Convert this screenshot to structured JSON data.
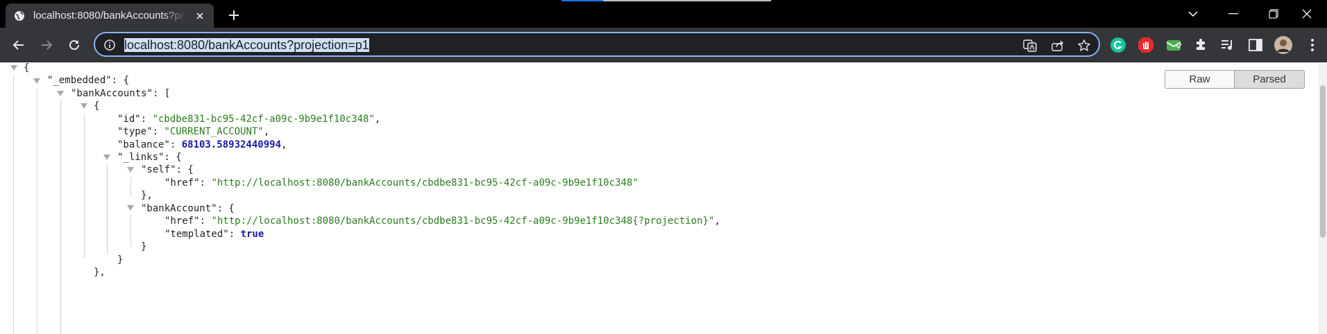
{
  "tab": {
    "title": "localhost:8080/bankAccounts?projection=p1"
  },
  "omnibox": {
    "url": "localhost:8080/bankAccounts?projection=p1"
  },
  "viewer": {
    "raw_label": "Raw",
    "parsed_label": "Parsed"
  },
  "json": {
    "open_brace": "{",
    "embedded_key": "\"_embedded\"",
    "bankaccounts_key": "\"bankAccounts\"",
    "id_key": "\"id\"",
    "id_value": "\"cbdbe831-bc95-42cf-a09c-9b9e1f10c348\"",
    "type_key": "\"type\"",
    "type_value": "\"CURRENT_ACCOUNT\"",
    "balance_key": "\"balance\"",
    "balance_value": "68103.58932440994",
    "links_key": "\"_links\"",
    "self_key": "\"self\"",
    "href_key": "\"href\"",
    "self_href": "\"http://localhost:8080/bankAccounts/cbdbe831-bc95-42cf-a09c-9b9e1f10c348\"",
    "bankaccount_key": "\"bankAccount\"",
    "bankaccount_href": "\"http://localhost:8080/bankAccounts/cbdbe831-bc95-42cf-a09c-9b9e1f10c348{?projection}\"",
    "templated_key": "\"templated\"",
    "templated_value": "true"
  },
  "colors": {
    "string": "#2a7a1e",
    "number": "#1a1aa6",
    "focus_ring": "#8ab4f8"
  }
}
